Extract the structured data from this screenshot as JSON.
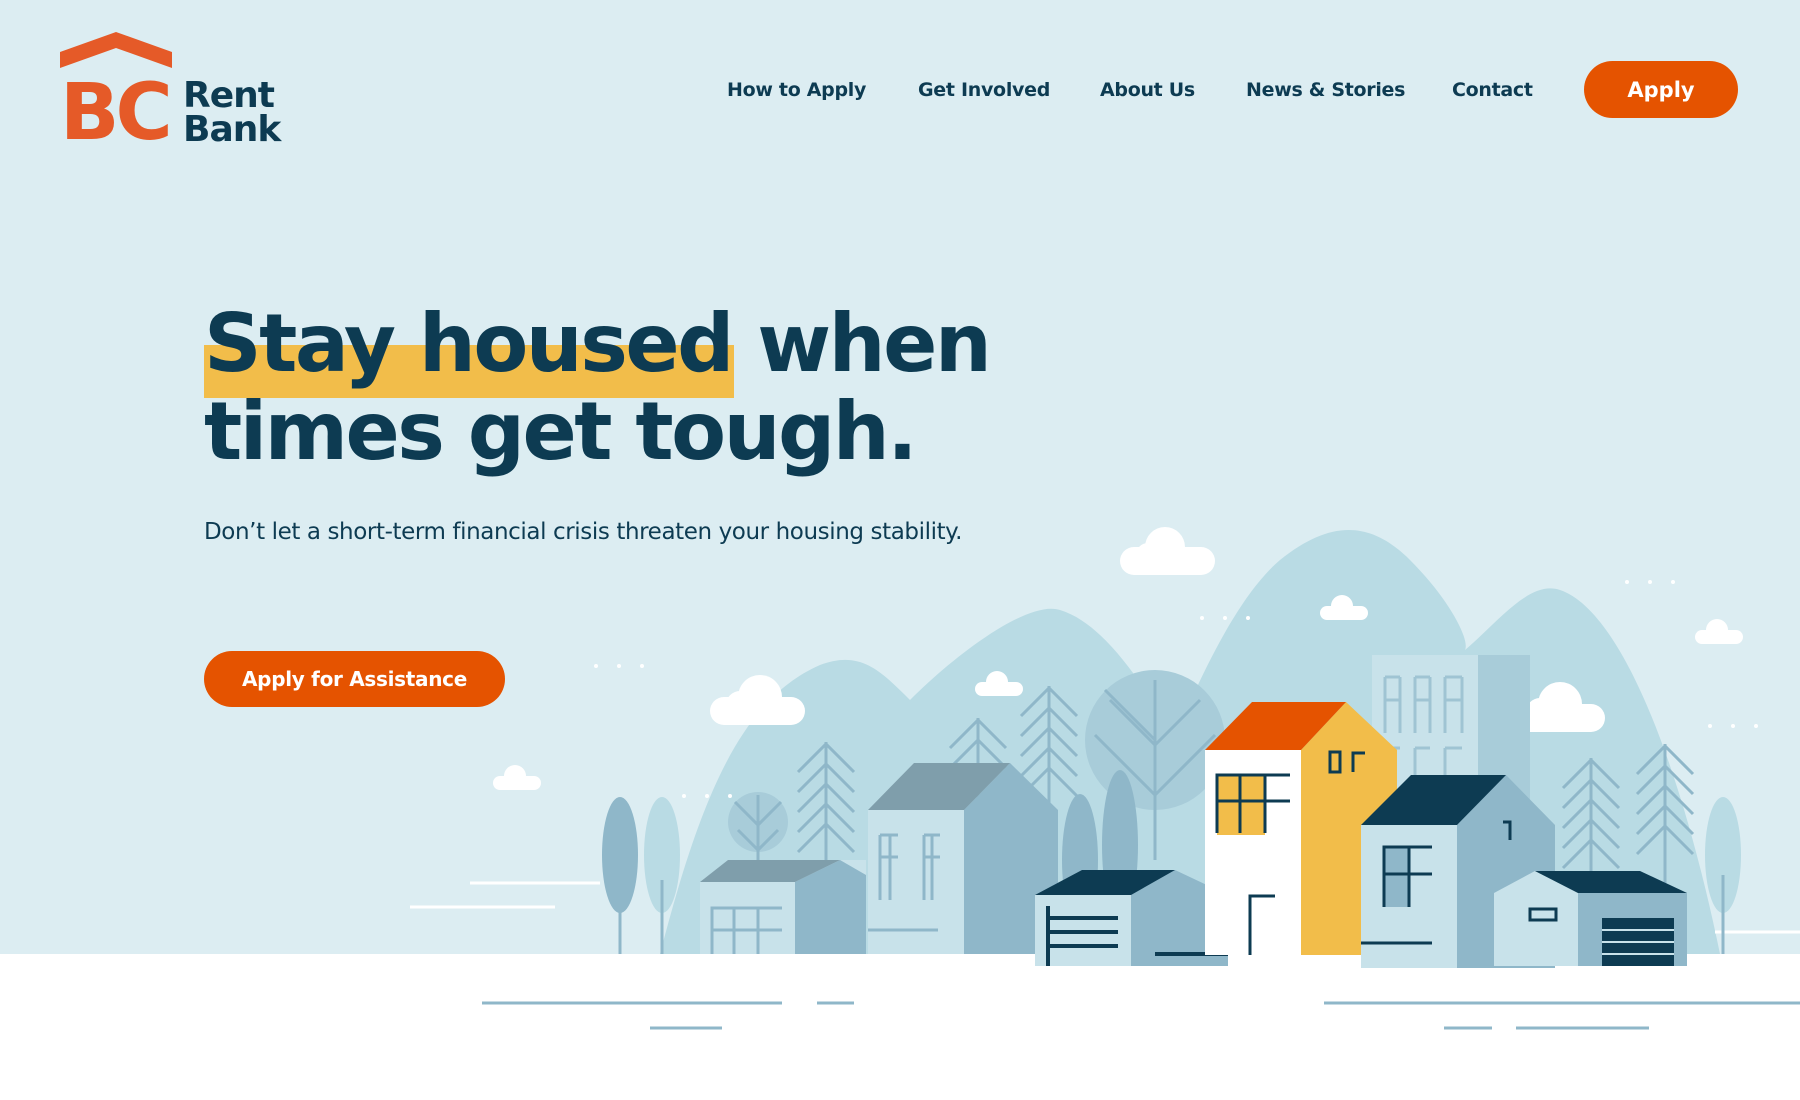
{
  "brand": {
    "logo_mark": "BC",
    "logo_word_1": "Rent",
    "logo_word_2": "Bank",
    "logo_icon": "house-roof-icon",
    "colors": {
      "primary_orange": "#e55300",
      "logo_orange": "#e55a28",
      "navy": "#0d3b52",
      "highlight_yellow": "#f2bd4a",
      "sky": "#dcedf2"
    }
  },
  "nav": {
    "items": [
      {
        "label": "How to Apply"
      },
      {
        "label": "Get Involved"
      },
      {
        "label": "About Us"
      },
      {
        "label": "News & Stories"
      },
      {
        "label": "Contact"
      }
    ],
    "apply_label": "Apply"
  },
  "hero": {
    "headline_highlight": "Stay housed",
    "headline_rest_line1": " when",
    "headline_line2": "times get tough.",
    "subtitle": "Don’t let a short-term financial crisis threaten your housing stability.",
    "cta_label": "Apply for Assistance"
  },
  "illustration": {
    "description": "neighbourhood-houses-mountains-illustration"
  }
}
